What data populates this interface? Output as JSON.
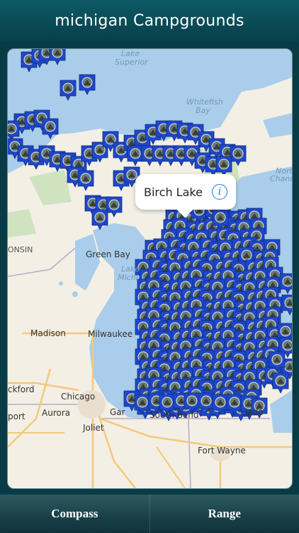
{
  "title": "michigan Campgrounds",
  "map": {
    "callout": {
      "name": "Birch Lake",
      "info_icon": "info-icon"
    },
    "labels": {
      "lake_superior_1": "Lake",
      "lake_superior_2": "Superior",
      "whitefish_1": "Whitefish",
      "whitefish_2": "Bay",
      "north_channel_1": "Nort",
      "north_channel_2": "Chann",
      "wisconsin": "ONSIN",
      "green_bay": "Green Bay",
      "lake_michigan_1": "Lake",
      "lake_michigan_2": "Michi",
      "madison": "Madison",
      "milwaukee": "Milwaukee",
      "rockford": "ckford",
      "chicago": "Chicago",
      "aurora": "Aurora",
      "freeport": "port",
      "joliet": "Joliet",
      "gary": "Gar",
      "south_bend": "South Bend",
      "toledo": "ledo",
      "fort_wayne": "Fort Wayne"
    },
    "marker_icon": "campground-pin-icon",
    "colors": {
      "water": "#a9cdea",
      "land": "#f3efe5",
      "pin": "#1f47c9",
      "forest": "#cfe3c0",
      "road": "#f3c97a"
    }
  },
  "tabs": {
    "compass": "Compass",
    "range": "Range"
  }
}
